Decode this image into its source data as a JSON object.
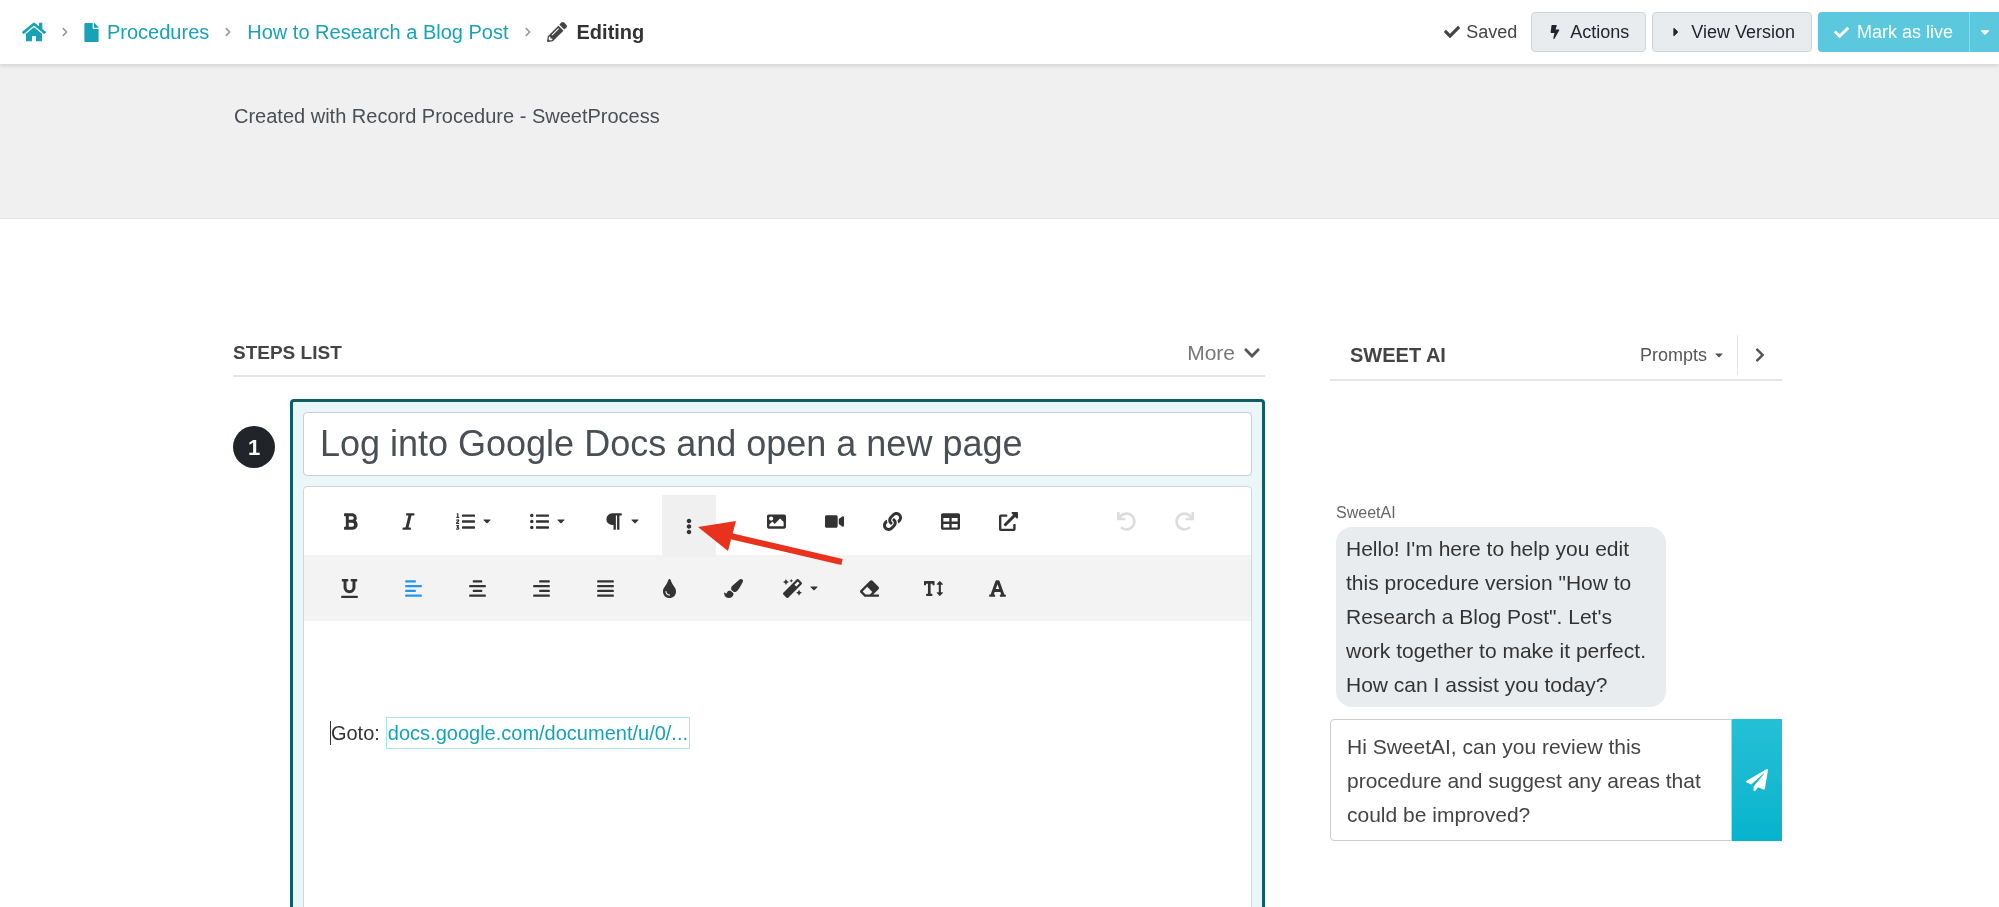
{
  "breadcrumb": {
    "items": [
      {
        "label": "Procedures",
        "kind": "doc"
      },
      {
        "label": "How to Research a Blog Post",
        "kind": "plain"
      }
    ],
    "current": "Editing"
  },
  "header_actions": {
    "status": "Saved",
    "buttons": [
      {
        "label": "Actions",
        "kind": "bolt"
      },
      {
        "label": "View Version",
        "kind": "play"
      },
      {
        "label": "Mark as live",
        "kind": "primary"
      }
    ]
  },
  "procedure": {
    "subtitle": "Created with Record Procedure - SweetProcess"
  },
  "steps_list": {
    "title": "STEPS LIST",
    "more": "More"
  },
  "steps": [
    {
      "number": "1",
      "title": "Log into Google Docs and open a new page",
      "body_prefix": "Goto:",
      "link": "docs.google.com/document/u/0/..."
    }
  ],
  "editor_toolbar": {
    "row_1": [
      {
        "disabled": false,
        "selected": false,
        "dropdown": false
      },
      {
        "disabled": false,
        "selected": false,
        "dropdown": false
      },
      {
        "disabled": false,
        "selected": false,
        "dropdown": true
      },
      {
        "disabled": false,
        "selected": false,
        "dropdown": true
      },
      {
        "disabled": false,
        "selected": false,
        "dropdown": true
      },
      {
        "disabled": false,
        "selected": true,
        "dropdown": false
      },
      {
        "disabled": false,
        "selected": false,
        "dropdown": false
      },
      {
        "disabled": false,
        "selected": false,
        "dropdown": false
      },
      {
        "disabled": false,
        "selected": false,
        "dropdown": false
      },
      {
        "disabled": false,
        "selected": false,
        "dropdown": false
      },
      {
        "disabled": false,
        "selected": false,
        "dropdown": false
      },
      {
        "disabled": true,
        "selected": false,
        "dropdown": false
      },
      {
        "disabled": true,
        "selected": false,
        "dropdown": false
      }
    ],
    "row_2": [
      {
        "active": false,
        "dropdown": false
      },
      {
        "active": true,
        "dropdown": false
      },
      {
        "active": false,
        "dropdown": false
      },
      {
        "active": false,
        "dropdown": false
      },
      {
        "active": false,
        "dropdown": false
      },
      {
        "active": false,
        "dropdown": false
      },
      {
        "active": false,
        "dropdown": false
      },
      {
        "active": false,
        "dropdown": true
      },
      {
        "active": false,
        "dropdown": false
      },
      {
        "active": false,
        "dropdown": false
      },
      {
        "active": false,
        "dropdown": false
      }
    ]
  },
  "sweet_ai": {
    "title": "SWEET AI",
    "prompts": "Prompts",
    "messages": [
      {
        "sender": "SweetAI",
        "text": "Hello! I'm here to help you edit this procedure version \"How to Research a Blog Post\". Let's work together to make it perfect. How can I assist you today?"
      }
    ],
    "input": {
      "value": "Hi SweetAI, can you review this procedure and suggest any areas that could be improved?"
    }
  }
}
